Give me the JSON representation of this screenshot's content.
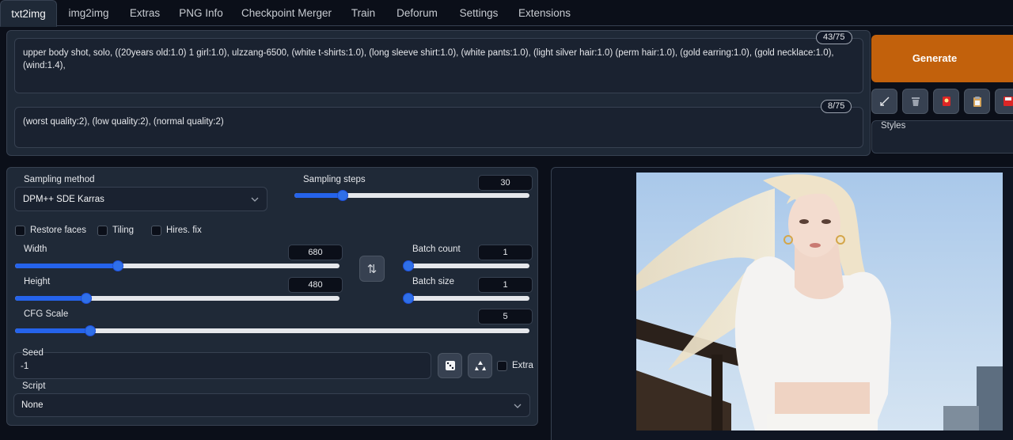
{
  "tabs": [
    "txt2img",
    "img2img",
    "Extras",
    "PNG Info",
    "Checkpoint Merger",
    "Train",
    "Deforum",
    "Settings",
    "Extensions"
  ],
  "prompt": {
    "positive": "upper body shot, solo, ((20years old:1.0) 1 girl:1.0), ulzzang-6500, (white t-shirts:1.0), (long sleeve shirt:1.0), (white pants:1.0), (light silver hair:1.0) (perm hair:1.0), (gold earring:1.0), (gold necklace:1.0), (wind:1.4),",
    "positive_count": "43/75",
    "negative": "(worst quality:2), (low quality:2), (normal quality:2)",
    "negative_count": "8/75"
  },
  "generate_label": "Generate",
  "styles_label": "Styles",
  "sampling": {
    "method_label": "Sampling method",
    "method_value": "DPM++ SDE Karras",
    "steps_label": "Sampling steps",
    "steps_value": "30"
  },
  "checkboxes": {
    "restore_faces": "Restore faces",
    "tiling": "Tiling",
    "hires": "Hires. fix"
  },
  "width": {
    "label": "Width",
    "value": "680"
  },
  "height": {
    "label": "Height",
    "value": "480"
  },
  "batch_count": {
    "label": "Batch count",
    "value": "1"
  },
  "batch_size": {
    "label": "Batch size",
    "value": "1"
  },
  "cfg": {
    "label": "CFG Scale",
    "value": "5"
  },
  "seed": {
    "label": "Seed",
    "value": "-1",
    "extra_label": "Extra"
  },
  "script": {
    "label": "Script",
    "value": "None"
  },
  "swap_glyph": "⇅",
  "colors": {
    "accent": "#2563eb",
    "generate": "#c2610c",
    "panel": "#1f2937",
    "background": "#0b0f19"
  }
}
